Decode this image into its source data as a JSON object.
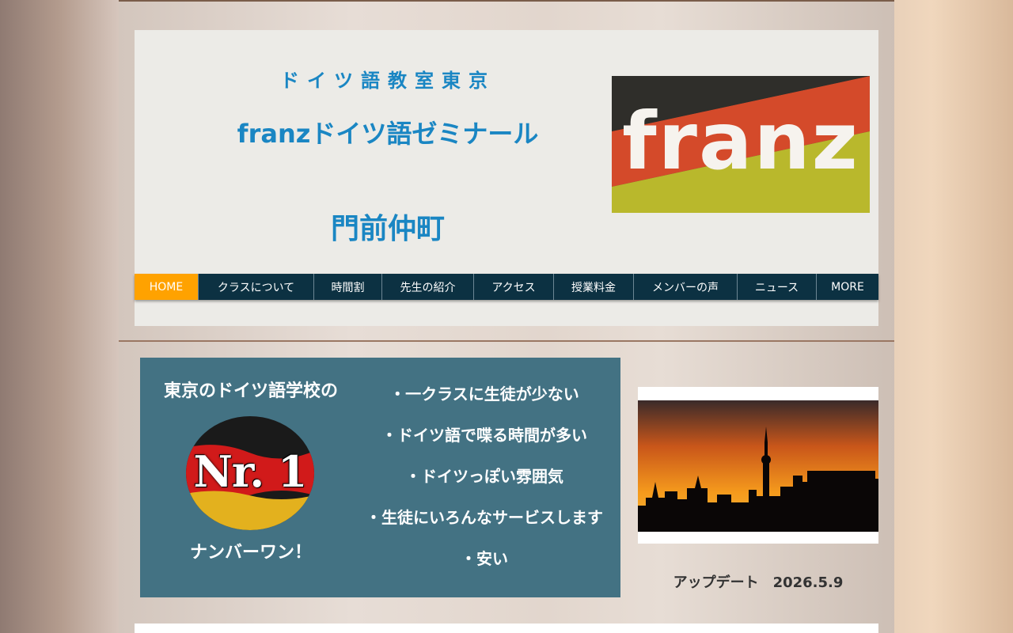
{
  "header": {
    "subtitle": "ドイツ語教室東京",
    "title": "franzドイツ語ゼミナール",
    "location": "門前仲町",
    "logo_text": "franz"
  },
  "nav": {
    "items": [
      {
        "label": "HOME",
        "active": true
      },
      {
        "label": "クラスについて",
        "active": false
      },
      {
        "label": "時間割",
        "active": false
      },
      {
        "label": "先生の紹介",
        "active": false
      },
      {
        "label": "アクセス",
        "active": false
      },
      {
        "label": "授業料金",
        "active": false
      },
      {
        "label": "メンバーの声",
        "active": false
      },
      {
        "label": "ニュース",
        "active": false
      },
      {
        "label": "MORE",
        "active": false
      }
    ]
  },
  "promo": {
    "heading": "東京のドイツ語学校の",
    "badge_text": "Nr. 1",
    "number_one": "ナンバーワン！",
    "features": [
      "・一クラスに生徒が少ない",
      "・ドイツ語で喋る時間が多い",
      "・ドイツっぽい雰囲気",
      "・生徒にいろんなサービスします",
      "・安い"
    ]
  },
  "update": {
    "text": "アップデート　2026.5.9"
  },
  "colors": {
    "accent_blue": "#1a86c3",
    "nav_bg": "#0c3142",
    "nav_active": "#ffa200",
    "promo_bg": "#437283"
  }
}
